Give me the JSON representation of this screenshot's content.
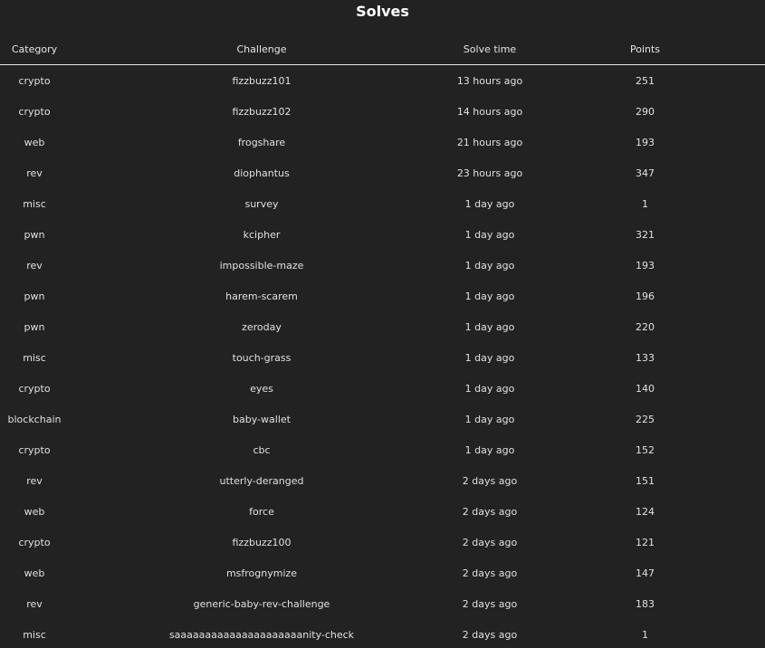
{
  "page": {
    "title": "Solves"
  },
  "table": {
    "headers": {
      "category": "Category",
      "challenge": "Challenge",
      "solve_time": "Solve time",
      "points": "Points"
    },
    "rows": [
      {
        "category": "crypto",
        "challenge": "fizzbuzz101",
        "solve_time": "13 hours ago",
        "points": "251"
      },
      {
        "category": "crypto",
        "challenge": "fizzbuzz102",
        "solve_time": "14 hours ago",
        "points": "290"
      },
      {
        "category": "web",
        "challenge": "frogshare",
        "solve_time": "21 hours ago",
        "points": "193"
      },
      {
        "category": "rev",
        "challenge": "diophantus",
        "solve_time": "23 hours ago",
        "points": "347"
      },
      {
        "category": "misc",
        "challenge": "survey",
        "solve_time": "1 day ago",
        "points": "1"
      },
      {
        "category": "pwn",
        "challenge": "kcipher",
        "solve_time": "1 day ago",
        "points": "321"
      },
      {
        "category": "rev",
        "challenge": "impossible-maze",
        "solve_time": "1 day ago",
        "points": "193"
      },
      {
        "category": "pwn",
        "challenge": "harem-scarem",
        "solve_time": "1 day ago",
        "points": "196"
      },
      {
        "category": "pwn",
        "challenge": "zeroday",
        "solve_time": "1 day ago",
        "points": "220"
      },
      {
        "category": "misc",
        "challenge": "touch-grass",
        "solve_time": "1 day ago",
        "points": "133"
      },
      {
        "category": "crypto",
        "challenge": "eyes",
        "solve_time": "1 day ago",
        "points": "140"
      },
      {
        "category": "blockchain",
        "challenge": "baby-wallet",
        "solve_time": "1 day ago",
        "points": "225"
      },
      {
        "category": "crypto",
        "challenge": "cbc",
        "solve_time": "1 day ago",
        "points": "152"
      },
      {
        "category": "rev",
        "challenge": "utterly-deranged",
        "solve_time": "2 days ago",
        "points": "151"
      },
      {
        "category": "web",
        "challenge": "force",
        "solve_time": "2 days ago",
        "points": "124"
      },
      {
        "category": "crypto",
        "challenge": "fizzbuzz100",
        "solve_time": "2 days ago",
        "points": "121"
      },
      {
        "category": "web",
        "challenge": "msfrognymize",
        "solve_time": "2 days ago",
        "points": "147"
      },
      {
        "category": "rev",
        "challenge": "generic-baby-rev-challenge",
        "solve_time": "2 days ago",
        "points": "183"
      },
      {
        "category": "misc",
        "challenge": "saaaaaaaaaaaaaaaaaaaaanity-check",
        "solve_time": "2 days ago",
        "points": "1"
      }
    ]
  },
  "colors": {
    "background": "#222222",
    "text": "#e6e6e6",
    "title": "#ffffff",
    "header_rule": "#e8e8e8"
  }
}
